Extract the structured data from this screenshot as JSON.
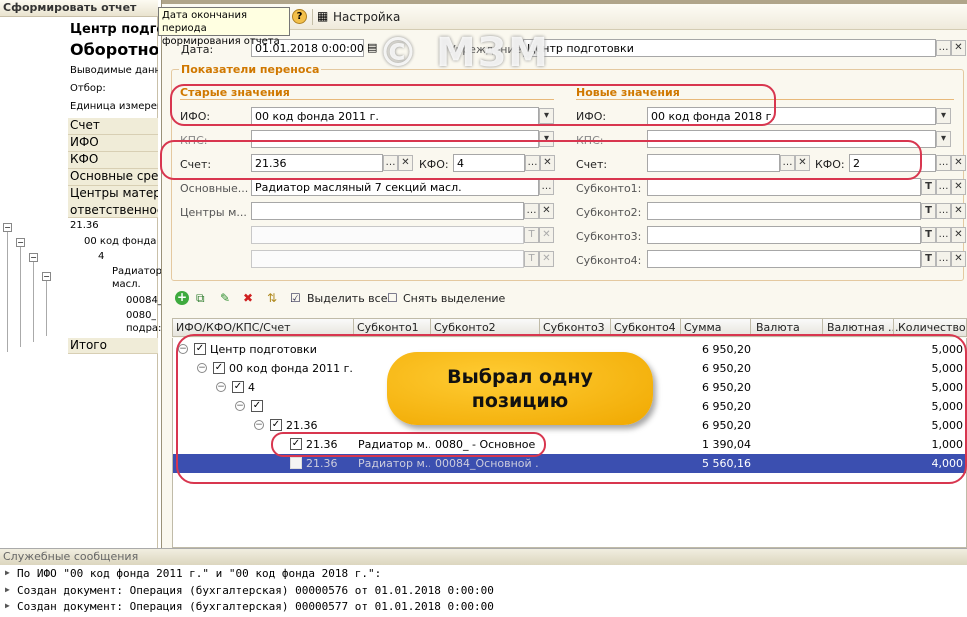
{
  "left_report": {
    "button": "Сформировать отчет",
    "header1": "Центр подгото",
    "header2": "Оборотно-",
    "rows": [
      "Выводимые данн",
      "Отбор:",
      "Единица измерен"
    ],
    "cols": [
      "Счет",
      "ИФО",
      "КФО",
      "Основные сре,",
      "Центры матер",
      "ответственност"
    ],
    "tree": [
      "21.36",
      "00 код фонда 2",
      "4",
      "Радиатор",
      "масл.",
      "00084_",
      "0080_",
      "подра:"
    ],
    "total": "Итого"
  },
  "tooltip": {
    "line1": "Дата окончания периода",
    "line2": "формирования отчета"
  },
  "toolbar": {
    "settings": "Настройка"
  },
  "watermark": "© МЗМ",
  "form": {
    "date_label": "Дата:",
    "date_value": "01.01.2018  0:00:00",
    "org_label": "Учреждение:",
    "org_value": "Центр подготовки",
    "group_title": "Показатели переноса",
    "old_title": "Старые значения",
    "new_title": "Новые значения",
    "ifo_label": "ИФО:",
    "old_ifo": "00 код фонда 2011 г.",
    "new_ifo": "00 код фонда 2018 г.",
    "kps_label": "КПС:",
    "old_kps": "",
    "new_kps": "",
    "schet_label": "Счет:",
    "old_schet": "21.36",
    "new_schet": "",
    "kfo_label": "КФО:",
    "old_kfo": "4",
    "new_kfo": "2",
    "os_label": "Основные...",
    "os_value": "Радиатор масляный 7 секций масл.",
    "cm_label": "Центры м...",
    "sub1": "Субконто1:",
    "sub2": "Субконто2:",
    "sub3": "Субконто3:",
    "sub4": "Субконто4:"
  },
  "grid_toolbar": {
    "select_all": "Выделить все",
    "deselect": "Снять выделение"
  },
  "grid": {
    "columns": [
      "ИФО/КФО/КПС/Счет",
      "Субконто1",
      "Субконто2",
      "Субконто3",
      "Субконто4",
      "Сумма",
      "Валюта",
      "Валютная ...",
      "Количество"
    ],
    "rows": [
      {
        "name": "Центр подготовки",
        "s1": "",
        "s2": "",
        "sum": "6 950,20",
        "qty": "5,000"
      },
      {
        "name": "00 код фонда 2011 г.",
        "s1": "",
        "s2": "",
        "sum": "6 950,20",
        "qty": "5,000"
      },
      {
        "name": "4",
        "s1": "",
        "s2": "",
        "sum": "6 950,20",
        "qty": "5,000"
      },
      {
        "name": "",
        "s1": "",
        "s2": "",
        "sum": "6 950,20",
        "qty": "5,000"
      },
      {
        "name": "21.36",
        "s1": "",
        "s2": "",
        "sum": "6 950,20",
        "qty": "5,000"
      },
      {
        "name": "21.36",
        "s1": "Радиатор м...",
        "s2": "0080_ - Основное ...",
        "sum": "1 390,04",
        "qty": "1,000"
      },
      {
        "name": "21.36",
        "s1": "Радиатор м...",
        "s2": "00084_Основной ...",
        "sum": "5 560,16",
        "qty": "4,000"
      }
    ]
  },
  "callout": {
    "line1": "Выбрал одну",
    "line2": "позицию"
  },
  "messages": {
    "title": "Служебные сообщения",
    "lines": [
      "По ИФО \"00 код фонда 2011 г.\" и \"00 код фонда 2018 г.\":",
      "Создан документ: Операция (бухгалтерская) 00000576 от 01.01.2018 0:00:00",
      "Создан документ: Операция (бухгалтерская) 00000577 от 01.01.2018 0:00:00"
    ]
  },
  "colors": {
    "accent_orange": "#d07800",
    "selection": "#3b4fb0",
    "annotation_red": "#d8364f",
    "callout": "#f0a800"
  }
}
